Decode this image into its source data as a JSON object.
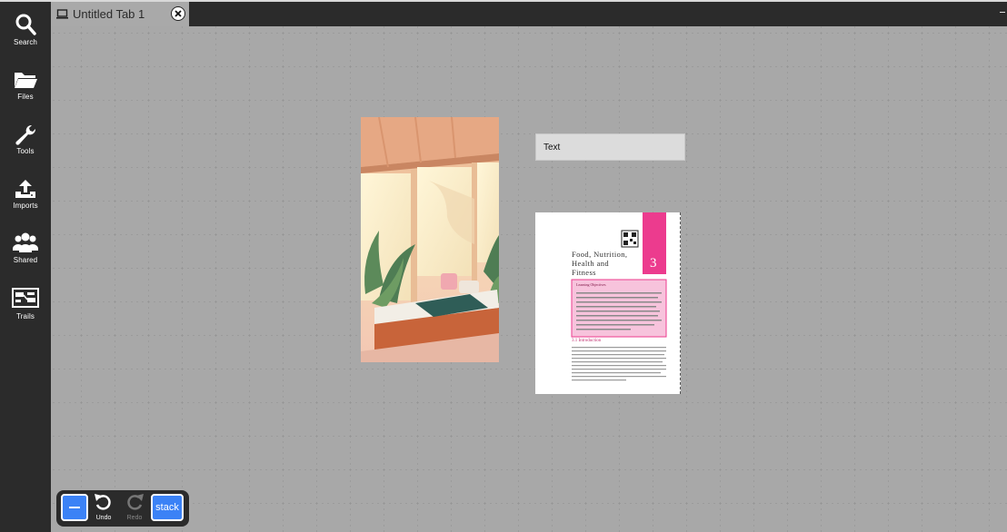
{
  "tab": {
    "title": "Untitled Tab 1"
  },
  "sidebar": {
    "items": [
      {
        "label": "Search",
        "icon": "search-icon"
      },
      {
        "label": "Files",
        "icon": "folder-icon"
      },
      {
        "label": "Tools",
        "icon": "wrench-icon"
      },
      {
        "label": "Imports",
        "icon": "upload-icon"
      },
      {
        "label": "Shared",
        "icon": "users-icon"
      },
      {
        "label": "Trails",
        "icon": "trails-icon"
      }
    ]
  },
  "canvas": {
    "text_card": {
      "text": "Text"
    },
    "document": {
      "title_line1": "Food, Nutrition,",
      "title_line2": "Health and",
      "title_line3": "Fitness",
      "chapter_number": "3",
      "box_heading": "Learning Objectives",
      "section_heading": "3.1 Introduction"
    }
  },
  "toolbar": {
    "undo_label": "Undo",
    "redo_label": "Redo",
    "stack_label": "stack"
  },
  "colors": {
    "accent": "#3b82f6",
    "sidebar_bg": "#2b2b2b",
    "canvas_bg": "#a8a8a8",
    "doc_accent": "#ec3b8e"
  }
}
